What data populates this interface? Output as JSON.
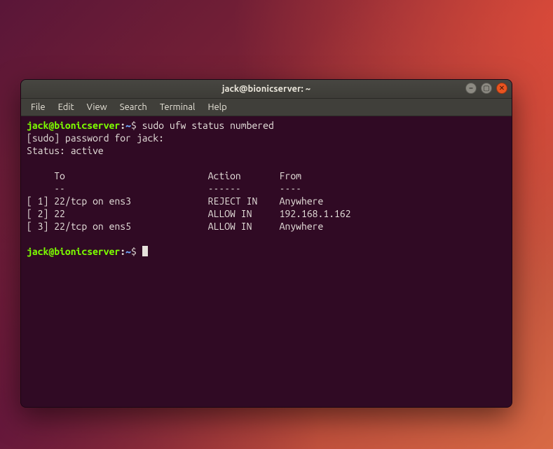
{
  "window": {
    "title": "jack@bionicserver: ~"
  },
  "menubar": {
    "items": [
      "File",
      "Edit",
      "View",
      "Search",
      "Terminal",
      "Help"
    ]
  },
  "prompt": {
    "userhost": "jack@bionicserver",
    "path": "~",
    "symbol": "$"
  },
  "session": {
    "command1": "sudo ufw status numbered",
    "sudo_prompt": "[sudo] password for jack:",
    "status_line": "Status: active",
    "header": {
      "to": "To",
      "action": "Action",
      "from": "From",
      "to_underline": "--",
      "action_underline": "------",
      "from_underline": "----"
    },
    "rules": [
      {
        "num": "[ 1]",
        "to": "22/tcp on ens3",
        "action": "REJECT IN",
        "from": "Anywhere"
      },
      {
        "num": "[ 2]",
        "to": "22",
        "action": "ALLOW IN",
        "from": "192.168.1.162"
      },
      {
        "num": "[ 3]",
        "to": "22/tcp on ens5",
        "action": "ALLOW IN",
        "from": "Anywhere"
      }
    ]
  }
}
